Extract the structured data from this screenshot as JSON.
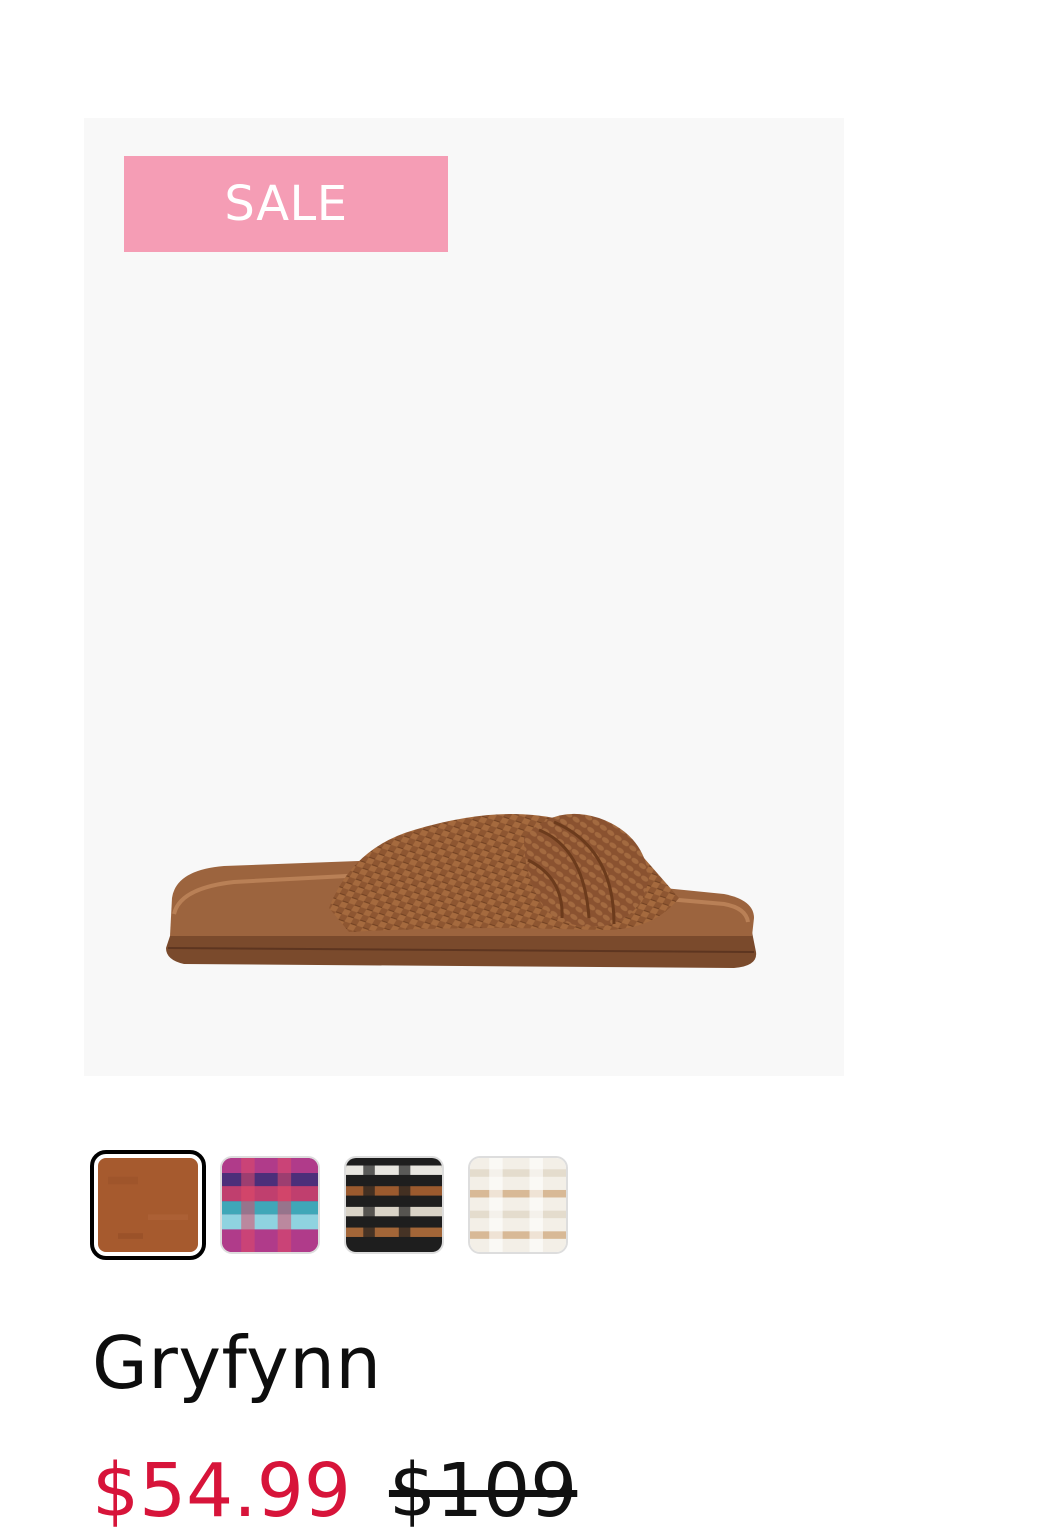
{
  "product": {
    "badge": "SALE",
    "name": "Gryfynn",
    "sale_price": "$54.99",
    "original_price": "$109",
    "image_icon": "sandal-image",
    "swatches": [
      {
        "name": "cognac",
        "color": "#a65a2e",
        "selected": true
      },
      {
        "name": "berry-multi",
        "color": "#b03b8a",
        "selected": false
      },
      {
        "name": "black-multi",
        "color": "#2b2b2b",
        "selected": false
      },
      {
        "name": "natural-multi",
        "color": "#ece4d6",
        "selected": false
      }
    ]
  },
  "colors": {
    "badge_bg": "#f59db5",
    "sale_price": "#d7143a",
    "image_bg": "#f8f8f8"
  }
}
